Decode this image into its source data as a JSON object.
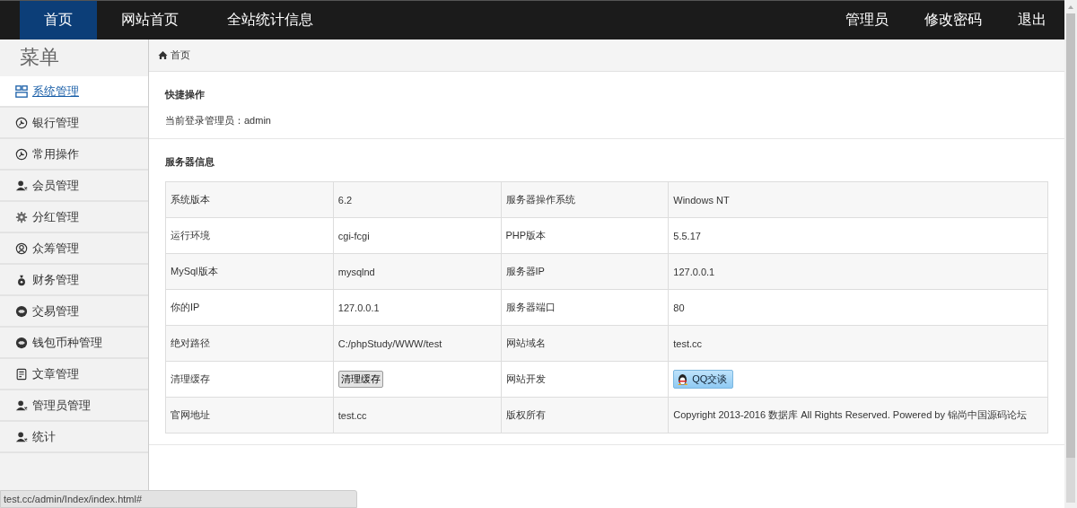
{
  "top_nav": {
    "left": [
      {
        "label": "首页",
        "selected": true
      },
      {
        "label": "网站首页",
        "selected": false
      },
      {
        "label": "全站统计信息",
        "selected": false
      }
    ],
    "right": [
      "管理员",
      "修改密码",
      "退出"
    ]
  },
  "sidebar": {
    "title": "菜单",
    "items": [
      {
        "label": "系统管理",
        "selected": true
      },
      {
        "label": "银行管理",
        "selected": false
      },
      {
        "label": "常用操作",
        "selected": false
      },
      {
        "label": "会员管理",
        "selected": false
      },
      {
        "label": "分红管理",
        "selected": false
      },
      {
        "label": "众筹管理",
        "selected": false
      },
      {
        "label": "财务管理",
        "selected": false
      },
      {
        "label": "交易管理",
        "selected": false
      },
      {
        "label": "钱包币种管理",
        "selected": false
      },
      {
        "label": "文章管理",
        "selected": false
      },
      {
        "label": "管理员管理",
        "selected": false
      },
      {
        "label": "统计",
        "selected": false
      }
    ]
  },
  "breadcrumb": "首页",
  "quick_actions": {
    "title": "快捷操作",
    "text": "当前登录管理员：admin"
  },
  "server_info": {
    "title": "服务器信息",
    "rows": [
      {
        "cells": [
          {
            "kind": "text",
            "text": "系统版本"
          },
          {
            "kind": "text",
            "text": "6.2"
          },
          {
            "kind": "text",
            "text": "服务器操作系统"
          },
          {
            "kind": "text",
            "text": "Windows NT"
          }
        ]
      },
      {
        "cells": [
          {
            "kind": "text",
            "text": "运行环境"
          },
          {
            "kind": "text",
            "text": "cgi-fcgi"
          },
          {
            "kind": "text",
            "text": "PHP版本"
          },
          {
            "kind": "text",
            "text": "5.5.17"
          }
        ]
      },
      {
        "cells": [
          {
            "kind": "text",
            "text": "MySql版本"
          },
          {
            "kind": "text",
            "text": "mysqlnd"
          },
          {
            "kind": "text",
            "text": "服务器IP"
          },
          {
            "kind": "text",
            "text": "127.0.0.1"
          }
        ]
      },
      {
        "cells": [
          {
            "kind": "text",
            "text": "你的IP"
          },
          {
            "kind": "text",
            "text": "127.0.0.1"
          },
          {
            "kind": "text",
            "text": "服务器端口"
          },
          {
            "kind": "text",
            "text": "80"
          }
        ]
      },
      {
        "cells": [
          {
            "kind": "text",
            "text": "绝对路径"
          },
          {
            "kind": "text",
            "text": "C:/phpStudy/WWW/test"
          },
          {
            "kind": "text",
            "text": "网站域名"
          },
          {
            "kind": "text",
            "text": "test.cc"
          }
        ]
      },
      {
        "cells": [
          {
            "kind": "text",
            "text": "清理缓存"
          },
          {
            "kind": "button",
            "text": "清理缓存"
          },
          {
            "kind": "text",
            "text": "网站开发"
          },
          {
            "kind": "qq",
            "text": "QQ交谈"
          }
        ]
      },
      {
        "cells": [
          {
            "kind": "text",
            "text": "官网地址"
          },
          {
            "kind": "text",
            "text": "test.cc"
          },
          {
            "kind": "text",
            "text": "版权所有"
          },
          {
            "kind": "text",
            "text": "Copyright 2013-2016 数据库 All Rights Reserved. Powered by 锦尚中国源码论坛"
          }
        ]
      }
    ]
  },
  "status_bar": "test.cc/admin/Index/index.html#"
}
